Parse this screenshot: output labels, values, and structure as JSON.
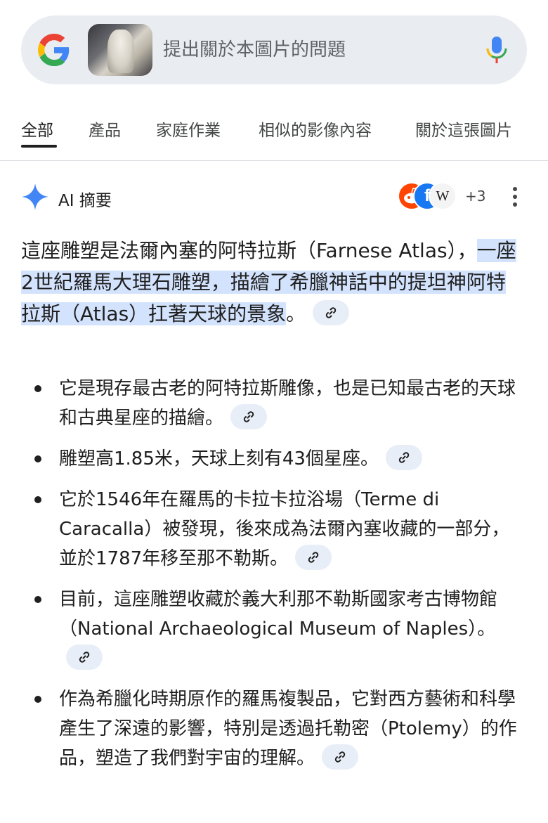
{
  "search": {
    "placeholder": "提出關於本圖片的問題",
    "logo_icon": "google-g-icon",
    "mic_icon": "microphone-icon"
  },
  "tabs": [
    {
      "label": "全部",
      "active": true
    },
    {
      "label": "產品",
      "active": false
    },
    {
      "label": "家庭作業",
      "active": false
    },
    {
      "label": "相似的影像內容",
      "active": false
    },
    {
      "label": "關於這張圖片",
      "active": false
    }
  ],
  "ai_overview": {
    "title": "AI 摘要",
    "sources": [
      "reddit-icon",
      "facebook-icon",
      "wikipedia-icon"
    ],
    "sources_more": "+3",
    "summary_plain": "這座雕塑是法爾內塞的阿特拉斯（Farnese Atlas），",
    "summary_highlight": "一座2世紀羅馬大理石雕塑，描繪了希臘神話中的提坦神阿特拉斯（Atlas）扛著天球的景象",
    "summary_end": "。",
    "bullets": [
      "它是現存最古老的阿特拉斯雕像，也是已知最古老的天球和古典星座的描繪。",
      "雕塑高1.85米，天球上刻有43個星座。",
      "它於1546年在羅馬的卡拉卡拉浴場（Terme di Caracalla）被發現，後來成為法爾內塞收藏的一部分，並於1787年移至那不勒斯。",
      "目前，這座雕塑收藏於義大利那不勒斯國家考古博物館（National Archaeological Museum of Naples）。",
      "作為希臘化時期原作的羅馬複製品，它對西方藝術和科學產生了深遠的影響，特別是透過托勒密（Ptolemy）的作品，塑造了我們對宇宙的理解。"
    ]
  },
  "colors": {
    "highlight": "#d3e3fd",
    "chip_bg": "#e8eef8",
    "search_bg": "#e9ecf1",
    "sparkle": "#4285f4"
  }
}
